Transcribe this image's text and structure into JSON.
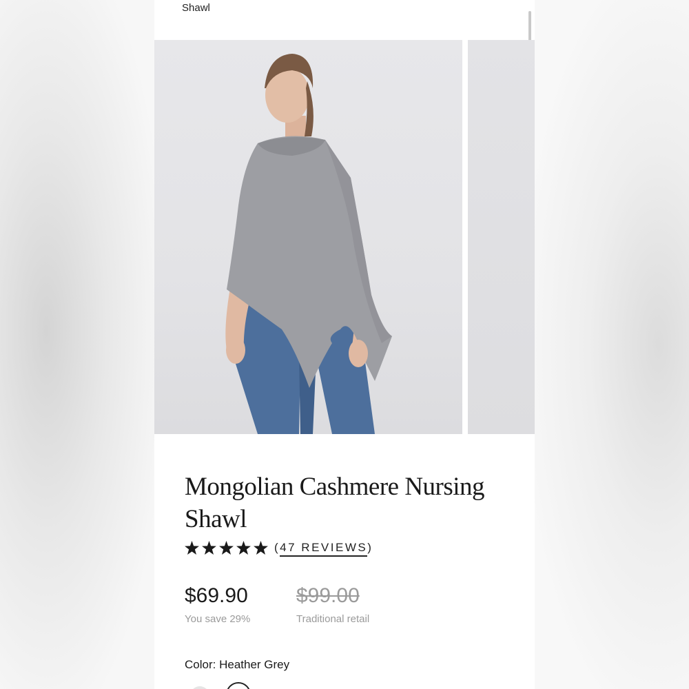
{
  "breadcrumb": {
    "text": "Shawl"
  },
  "gallery": {
    "main_image": "model-wearing-grey-cashmere-shawl",
    "next_image": "next-product-image-partial"
  },
  "product": {
    "title": "Mongolian Cashmere Nursing Shawl",
    "rating": {
      "stars": 5,
      "reviews_open": "(",
      "reviews_link": "47 REVIEWS",
      "reviews_close": ")"
    },
    "price": "$69.90",
    "savings": "You save 29%",
    "original_price": "$99.00",
    "original_label": "Traditional retail",
    "color_label": "Color:",
    "color_value": "Heather Grey"
  },
  "colors": {
    "star": "#1a1a1a",
    "shawl": "#9d9ea3",
    "jeans": "#4d6f9c",
    "muted_text": "#9a9a9a"
  }
}
